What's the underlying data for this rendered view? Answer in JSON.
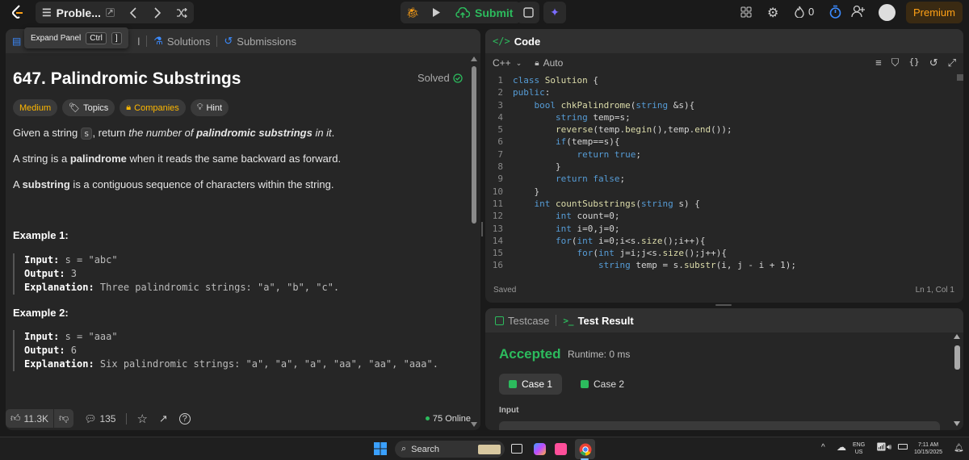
{
  "topbar": {
    "problem_title": "Proble...",
    "submit_label": "Submit",
    "streak_count": "0",
    "premium_label": "Premium"
  },
  "tooltip": {
    "label": "Expand Panel",
    "key1": "Ctrl",
    "key2": "]"
  },
  "left_tabs": {
    "hidden_tab": "l",
    "solutions": "Solutions",
    "submissions": "Submissions"
  },
  "problem": {
    "title": "647. Palindromic Substrings",
    "solved_label": "Solved",
    "chips": {
      "difficulty": "Medium",
      "topics": "Topics",
      "companies": "Companies",
      "hint": "Hint"
    },
    "desc1_a": "Given a string ",
    "desc1_code": "s",
    "desc1_b": ", return ",
    "desc1_c": "the number of ",
    "desc1_d": "palindromic substrings",
    "desc1_e": " in it",
    "desc1_f": ".",
    "desc2_a": "A string is a ",
    "desc2_b": "palindrome",
    "desc2_c": " when it reads the same backward as forward.",
    "desc3_a": "A ",
    "desc3_b": "substring",
    "desc3_c": " is a contiguous sequence of characters within the string.",
    "examples": [
      {
        "heading": "Example 1:",
        "input_label": "Input:",
        "input": " s = \"abc\"",
        "output_label": "Output:",
        "output": " 3",
        "expl_label": "Explanation:",
        "expl": " Three palindromic strings: \"a\", \"b\", \"c\"."
      },
      {
        "heading": "Example 2:",
        "input_label": "Input:",
        "input": " s = \"aaa\"",
        "output_label": "Output:",
        "output": " 6",
        "expl_label": "Explanation:",
        "expl": " Six palindromic strings: \"a\", \"a\", \"a\", \"aa\", \"aa\", \"aaa\"."
      }
    ],
    "likes": "11.3K",
    "comments": "135",
    "online": "75 Online"
  },
  "editor": {
    "tab_label": "Code",
    "language": "C++",
    "mode": "Auto",
    "status_left": "Saved",
    "status_right": "Ln 1, Col 1",
    "lines": [
      {
        "n": "1",
        "parts": [
          [
            "kw",
            "class "
          ],
          [
            "fn",
            "Solution"
          ],
          [
            "tx",
            " {"
          ]
        ]
      },
      {
        "n": "2",
        "parts": [
          [
            "kw",
            "public"
          ],
          [
            "tx",
            ":"
          ]
        ]
      },
      {
        "n": "3",
        "parts": [
          [
            "tx",
            "    "
          ],
          [
            "kw",
            "bool "
          ],
          [
            "fn",
            "chkPalindrome"
          ],
          [
            "tx",
            "("
          ],
          [
            "kw",
            "string "
          ],
          [
            "tx",
            "&s){"
          ]
        ]
      },
      {
        "n": "4",
        "parts": [
          [
            "tx",
            "        "
          ],
          [
            "kw",
            "string "
          ],
          [
            "tx",
            "temp=s;"
          ]
        ]
      },
      {
        "n": "5",
        "parts": [
          [
            "tx",
            "        "
          ],
          [
            "fn",
            "reverse"
          ],
          [
            "tx",
            "(temp."
          ],
          [
            "fn",
            "begin"
          ],
          [
            "tx",
            "(),temp."
          ],
          [
            "fn",
            "end"
          ],
          [
            "tx",
            "());"
          ]
        ]
      },
      {
        "n": "6",
        "parts": [
          [
            "tx",
            "        "
          ],
          [
            "kw",
            "if"
          ],
          [
            "tx",
            "(temp==s){"
          ]
        ]
      },
      {
        "n": "7",
        "parts": [
          [
            "tx",
            "            "
          ],
          [
            "kw",
            "return true"
          ],
          [
            "tx",
            ";"
          ]
        ]
      },
      {
        "n": "8",
        "parts": [
          [
            "tx",
            "        }"
          ]
        ]
      },
      {
        "n": "9",
        "parts": [
          [
            "tx",
            "        "
          ],
          [
            "kw",
            "return false"
          ],
          [
            "tx",
            ";"
          ]
        ]
      },
      {
        "n": "10",
        "parts": [
          [
            "tx",
            "    }"
          ]
        ]
      },
      {
        "n": "11",
        "parts": [
          [
            "tx",
            "    "
          ],
          [
            "kw",
            "int "
          ],
          [
            "fn",
            "countSubstrings"
          ],
          [
            "tx",
            "("
          ],
          [
            "kw",
            "string "
          ],
          [
            "tx",
            "s) {"
          ]
        ]
      },
      {
        "n": "12",
        "parts": [
          [
            "tx",
            "        "
          ],
          [
            "kw",
            "int "
          ],
          [
            "tx",
            "count=0;"
          ]
        ]
      },
      {
        "n": "13",
        "parts": [
          [
            "tx",
            "        "
          ],
          [
            "kw",
            "int "
          ],
          [
            "tx",
            "i=0,j=0;"
          ]
        ]
      },
      {
        "n": "14",
        "parts": [
          [
            "tx",
            "        "
          ],
          [
            "kw",
            "for"
          ],
          [
            "tx",
            "("
          ],
          [
            "kw",
            "int "
          ],
          [
            "tx",
            "i=0;i<s."
          ],
          [
            "fn",
            "size"
          ],
          [
            "tx",
            "();i++){"
          ]
        ]
      },
      {
        "n": "15",
        "parts": [
          [
            "tx",
            "            "
          ],
          [
            "kw",
            "for"
          ],
          [
            "tx",
            "("
          ],
          [
            "kw",
            "int "
          ],
          [
            "tx",
            "j=i;j<s."
          ],
          [
            "fn",
            "size"
          ],
          [
            "tx",
            "();j++){"
          ]
        ]
      },
      {
        "n": "16",
        "parts": [
          [
            "tx",
            "                "
          ],
          [
            "kw",
            "string "
          ],
          [
            "tx",
            "temp = s."
          ],
          [
            "fn",
            "substr"
          ],
          [
            "tx",
            "(i, j - i + 1);"
          ]
        ]
      }
    ]
  },
  "testpanel": {
    "testcase_tab": "Testcase",
    "result_tab": "Test Result",
    "verdict": "Accepted",
    "runtime": "Runtime: 0 ms",
    "case1": "Case 1",
    "case2": "Case 2",
    "input_label": "Input"
  },
  "taskbar": {
    "search_label": "Search",
    "lang_line1": "ENG",
    "lang_line2": "US",
    "time": "7:11 AM",
    "date": "10/15/2025"
  },
  "colors": {
    "accent_green": "#2cbb5d",
    "accent_orange": "#ffa116",
    "medium": "#ffb800"
  }
}
